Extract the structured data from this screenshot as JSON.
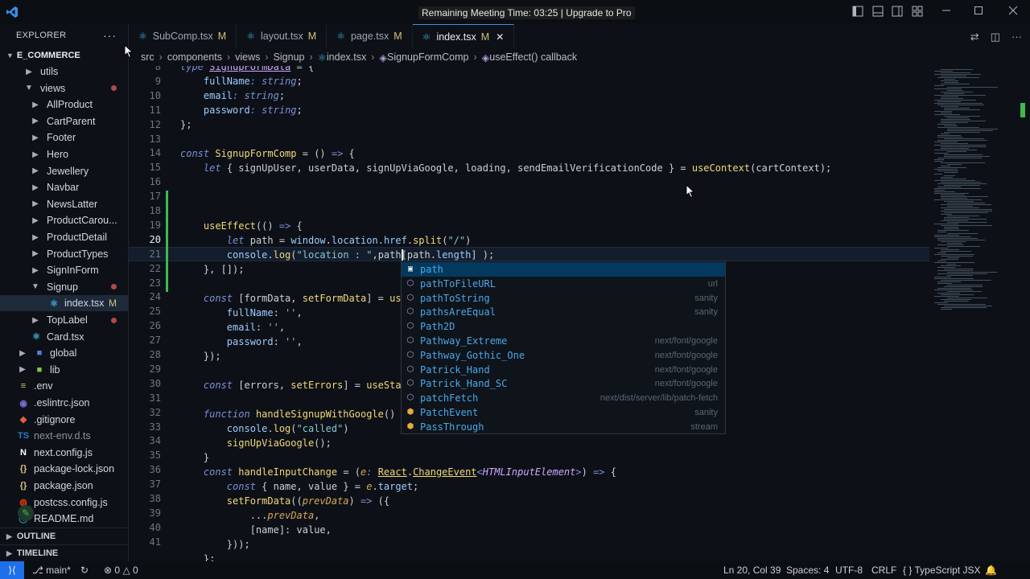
{
  "window": {
    "title": "Remaining Meeting Time: 03:25 | Upgrade to Pro"
  },
  "sidebar": {
    "header": "EXPLORER",
    "root": "E_COMMERCE",
    "items": [
      {
        "label": "utils",
        "type": "folder",
        "indent": 2,
        "state": "closed"
      },
      {
        "label": "views",
        "type": "folder",
        "indent": 2,
        "state": "open",
        "badge": "dot"
      },
      {
        "label": "AllProduct",
        "type": "folder",
        "indent": 3,
        "state": "closed"
      },
      {
        "label": "CartParent",
        "type": "folder",
        "indent": 3,
        "state": "closed"
      },
      {
        "label": "Footer",
        "type": "folder",
        "indent": 3,
        "state": "closed"
      },
      {
        "label": "Hero",
        "type": "folder",
        "indent": 3,
        "state": "closed"
      },
      {
        "label": "Jewellery",
        "type": "folder",
        "indent": 3,
        "state": "closed"
      },
      {
        "label": "Navbar",
        "type": "folder",
        "indent": 3,
        "state": "closed"
      },
      {
        "label": "NewsLatter",
        "type": "folder",
        "indent": 3,
        "state": "closed"
      },
      {
        "label": "ProductCarou...",
        "type": "folder",
        "indent": 3,
        "state": "closed"
      },
      {
        "label": "ProductDetail",
        "type": "folder",
        "indent": 3,
        "state": "closed"
      },
      {
        "label": "ProductTypes",
        "type": "folder",
        "indent": 3,
        "state": "closed"
      },
      {
        "label": "SignInForm",
        "type": "folder",
        "indent": 3,
        "state": "closed"
      },
      {
        "label": "Signup",
        "type": "folder",
        "indent": 3,
        "state": "open",
        "badge": "dot"
      },
      {
        "label": "index.tsx",
        "type": "tsx",
        "indent": 4,
        "mark": "M",
        "selected": true
      },
      {
        "label": "TopLabel",
        "type": "folder",
        "indent": 3,
        "state": "closed",
        "badge": "dot"
      },
      {
        "label": "Card.tsx",
        "type": "tsx",
        "indent": 3
      },
      {
        "label": "global",
        "type": "folder-blue",
        "indent": 1,
        "state": "closed"
      },
      {
        "label": "lib",
        "type": "folder-green",
        "indent": 1,
        "state": "closed"
      },
      {
        "label": ".env",
        "type": "env",
        "indent": 1
      },
      {
        "label": ".eslintrc.json",
        "type": "eslint",
        "indent": 1
      },
      {
        "label": ".gitignore",
        "type": "git",
        "indent": 1
      },
      {
        "label": "next-env.d.ts",
        "type": "ts",
        "indent": 1
      },
      {
        "label": "next.config.js",
        "type": "next",
        "indent": 1
      },
      {
        "label": "package-lock.json",
        "type": "json",
        "indent": 1
      },
      {
        "label": "package.json",
        "type": "json",
        "indent": 1
      },
      {
        "label": "postcss.config.js",
        "type": "postcss",
        "indent": 1
      },
      {
        "label": "README.md",
        "type": "md",
        "indent": 1
      }
    ],
    "outline": "OUTLINE",
    "timeline": "TIMELINE"
  },
  "tabs": [
    {
      "label": "SubComp.tsx",
      "mod": "M",
      "active": false
    },
    {
      "label": "layout.tsx",
      "mod": "M",
      "active": false
    },
    {
      "label": "page.tsx",
      "mod": "M",
      "active": false
    },
    {
      "label": "index.tsx",
      "mod": "M",
      "active": true
    }
  ],
  "breadcrumb": [
    "src",
    "components",
    "views",
    "Signup",
    "index.tsx",
    "SignupFormComp",
    "useEffect() callback"
  ],
  "editor": {
    "line_numbers": [
      "8",
      "9",
      "10",
      "11",
      "12",
      "13",
      "14",
      "15",
      "16",
      "17",
      "18",
      "19",
      "20",
      "21",
      "22",
      "23",
      "24",
      "25",
      "26",
      "27",
      "28",
      "29",
      "30",
      "31",
      "32",
      "33",
      "34",
      "35",
      "36",
      "37",
      "38",
      "39",
      "40",
      "41"
    ],
    "current_line": "20",
    "top_partial": "type SignupFormData = {"
  },
  "suggestions": [
    {
      "label": "path",
      "source": "",
      "icon": "var",
      "selected": true
    },
    {
      "label": "pathToFileURL",
      "source": "url",
      "icon": "cube"
    },
    {
      "label": "pathToString",
      "source": "sanity",
      "icon": "cube"
    },
    {
      "label": "pathsAreEqual",
      "source": "sanity",
      "icon": "cube"
    },
    {
      "label": "Path2D",
      "source": "",
      "icon": "cube"
    },
    {
      "label": "Pathway_Extreme",
      "source": "next/font/google",
      "icon": "cube"
    },
    {
      "label": "Pathway_Gothic_One",
      "source": "next/font/google",
      "icon": "cube"
    },
    {
      "label": "Patrick_Hand",
      "source": "next/font/google",
      "icon": "cube"
    },
    {
      "label": "Patrick_Hand_SC",
      "source": "next/font/google",
      "icon": "cube"
    },
    {
      "label": "patchFetch",
      "source": "next/dist/server/lib/patch-fetch",
      "icon": "cube"
    },
    {
      "label": "PatchEvent",
      "source": "sanity",
      "icon": "class"
    },
    {
      "label": "PassThrough",
      "source": "stream",
      "icon": "class"
    }
  ],
  "statusbar": {
    "branch": "main*",
    "errors": "0",
    "warnings": "0",
    "position": "Ln 20, Col 39",
    "spaces": "Spaces: 4",
    "encoding": "UTF-8",
    "eol": "CRLF",
    "language": "TypeScript JSX"
  },
  "colors": {
    "accent": "#1f6feb",
    "modified": "#d4c27b",
    "suggest_match": "#4aa8e8"
  }
}
